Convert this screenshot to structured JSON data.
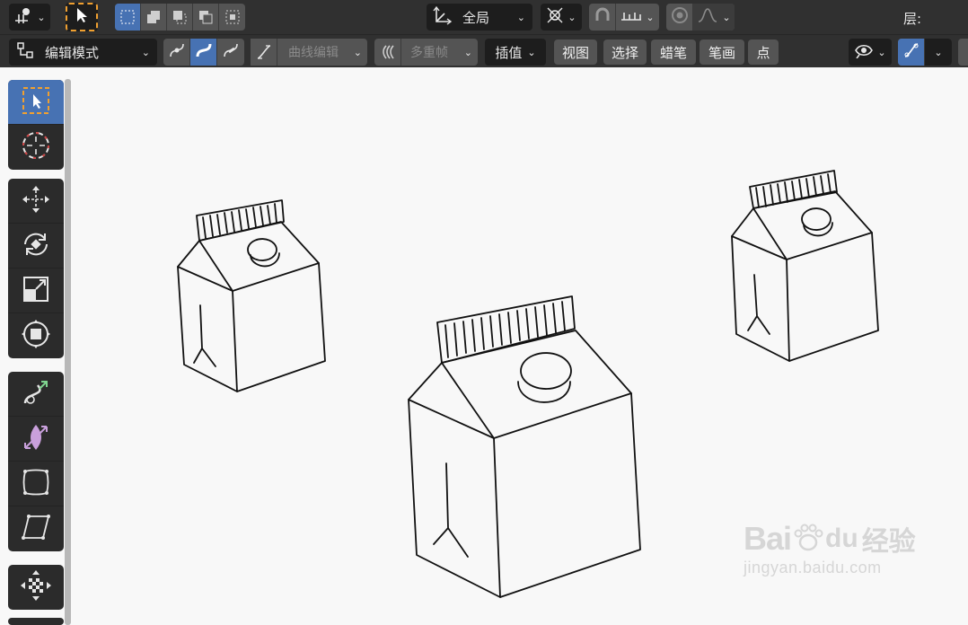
{
  "header": {
    "pivot_icon": "pivot-icon",
    "select_icon": "select-cursor-icon",
    "select_modes": [
      "set",
      "extend",
      "subtract",
      "invert",
      "intersect"
    ],
    "orientation_label": "全局",
    "proportional_icon": "proportional-edit-icon",
    "snap_icon": "snap-magnet-icon",
    "layer_label": "层:"
  },
  "toolbar": {
    "mode_label": "编辑模式",
    "curve_edit_label": "曲线编辑",
    "multiframe_label": "多重帧",
    "interp_label": "插值",
    "menus": [
      "视图",
      "选择",
      "蜡笔",
      "笔画",
      "点"
    ],
    "accent": "#4772b3"
  },
  "left_tools": [
    {
      "group": 1,
      "items": [
        "select-box-icon",
        "cursor-icon"
      ]
    },
    {
      "group": 2,
      "items": [
        "move-icon",
        "rotate-icon",
        "scale-icon",
        "transform-icon"
      ]
    },
    {
      "group": 3,
      "items": [
        "bend-icon",
        "shear-icon",
        "to-sphere-icon",
        "radius-icon"
      ]
    },
    {
      "group": 4,
      "items": [
        "interpolate-icon"
      ]
    }
  ],
  "watermark": {
    "brand": "Bai",
    "brand2": "du",
    "cn": "经验",
    "url": "jingyan.baidu.com"
  }
}
